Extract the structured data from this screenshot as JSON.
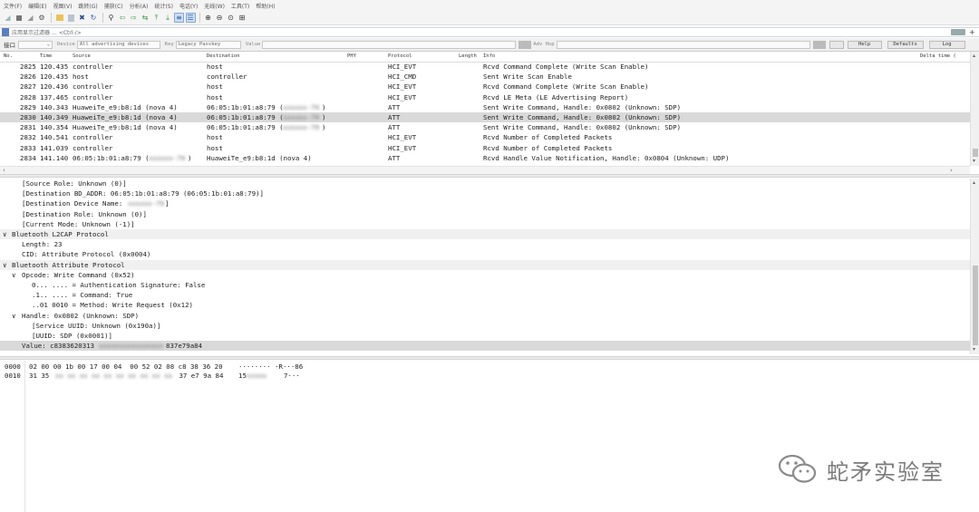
{
  "menu": [
    "文件(F)",
    "编辑(E)",
    "视图(V)",
    "跳转(G)",
    "捕获(C)",
    "分析(A)",
    "统计(S)",
    "电话(Y)",
    "无线(W)",
    "工具(T)",
    "帮助(H)"
  ],
  "filter": {
    "placeholder": "应用显示过滤器 … <Ctrl-/>"
  },
  "capture_options": {
    "interface_label": "接口",
    "device_label": "Device",
    "device_value": "All advertising devices",
    "key_label": "Key",
    "key_value": "Legacy Passkey",
    "value_label": "Value",
    "adv_hop_label": "Adv Hop",
    "help_label": "Help",
    "defaults_label": "Defaults",
    "log_label": "Log"
  },
  "columns": {
    "no": "No.",
    "time": "Time",
    "source": "Source",
    "destination": "Destination",
    "phy": "PHY",
    "protocol": "Protocol",
    "length": "Length",
    "info": "Info",
    "delta": "Delta time ("
  },
  "packets": [
    {
      "no": "2825",
      "time": "120.435",
      "src": "controller",
      "dst": "host",
      "proto": "HCI_EVT",
      "info": "Rcvd Command Complete (Write Scan Enable)"
    },
    {
      "no": "2826",
      "time": "120.435",
      "src": "host",
      "dst": "controller",
      "proto": "HCI_CMD",
      "info": "Sent Write Scan Enable"
    },
    {
      "no": "2827",
      "time": "120.436",
      "src": "controller",
      "dst": "host",
      "proto": "HCI_EVT",
      "info": "Rcvd Command Complete (Write Scan Enable)"
    },
    {
      "no": "2828",
      "time": "137.465",
      "src": "controller",
      "dst": "host",
      "proto": "HCI_EVT",
      "info": "Rcvd LE Meta (LE Advertising Report)"
    },
    {
      "no": "2829",
      "time": "140.343",
      "src": "HuaweiTe_e9:b8:1d (nova 4)",
      "dst": "06:05:1b:01:a8:79 (",
      "dst_blur": "xxxxxx-79",
      "dst_end": ")",
      "proto": "ATT",
      "info": "Sent Write Command, Handle: 0x0802 (Unknown: SDP)"
    },
    {
      "no": "2830",
      "time": "140.349",
      "src": "HuaweiTe_e9:b8:1d (nova 4)",
      "dst": "06:05:1b:01:a8:79 (",
      "dst_blur": "xxxxxx-79",
      "dst_end": ")",
      "proto": "ATT",
      "info": "Sent Write Command, Handle: 0x0802 (Unknown: SDP)"
    },
    {
      "no": "2831",
      "time": "140.354",
      "src": "HuaweiTe_e9:b8:1d (nova 4)",
      "dst": "06:05:1b:01:a8:79 (",
      "dst_blur": "xxxxxx-79",
      "dst_end": ")",
      "proto": "ATT",
      "info": "Sent Write Command, Handle: 0x0802 (Unknown: SDP)"
    },
    {
      "no": "2832",
      "time": "140.541",
      "src": "controller",
      "dst": "host",
      "proto": "HCI_EVT",
      "info": "Rcvd Number of Completed Packets"
    },
    {
      "no": "2833",
      "time": "141.039",
      "src": "controller",
      "dst": "host",
      "proto": "HCI_EVT",
      "info": "Rcvd Number of Completed Packets"
    },
    {
      "no": "2834",
      "time": "141.140",
      "src": "06:05:1b:01:a8:79 (",
      "src_blur": "xxxxxx-79",
      "src_end": ")",
      "dst": "HuaweiTe_e9:b8:1d (nova 4)",
      "proto": "ATT",
      "info": "Rcvd Handle Value Notification, Handle: 0x0804 (Unknown: UDP)"
    }
  ],
  "details": [
    {
      "indent": 3,
      "text": "[Source Role: Unknown (0)]"
    },
    {
      "indent": 3,
      "text": "[Destination BD_ADDR: 06:05:1b:01:a8:79 (06:05:1b:01:a8:79)]"
    },
    {
      "indent": 3,
      "text": "[Destination Device Name: ",
      "blur": "xxxxxx-79",
      "end": "]"
    },
    {
      "indent": 3,
      "text": "[Destination Role: Unknown (0)]"
    },
    {
      "indent": 3,
      "text": "[Current Mode: Unknown (-1)]"
    },
    {
      "indent": 0,
      "arrow": "∨",
      "text": "Bluetooth L2CAP Protocol",
      "section": true
    },
    {
      "indent": 3,
      "text": "Length: 23"
    },
    {
      "indent": 3,
      "text": "CID: Attribute Protocol (0x0004)"
    },
    {
      "indent": 0,
      "arrow": "∨",
      "text": "Bluetooth Attribute Protocol",
      "section": true
    },
    {
      "indent": 1,
      "arrow": "∨",
      "text": "Opcode: Write Command (0x52)"
    },
    {
      "indent": 4,
      "text": "0... .... = Authentication Signature: False"
    },
    {
      "indent": 4,
      "text": ".1.. .... = Command: True"
    },
    {
      "indent": 4,
      "text": "..01 0010 = Method: Write Request (0x12)"
    },
    {
      "indent": 1,
      "arrow": "∨",
      "text": "Handle: 0x0802 (Unknown: SDP)"
    },
    {
      "indent": 4,
      "text": "[Service UUID: Unknown (0x190a)]"
    },
    {
      "indent": 4,
      "text": "[UUID: SDP (0x0001)]"
    },
    {
      "indent": 3,
      "text": "Value: c8383620313",
      "blur": "xxxxxxxxxxxxxxxx",
      "end": "837e79a84",
      "selected": true
    }
  ],
  "bytes": [
    {
      "offset": "0000",
      "hex": "02 00 00 1b 00 17 00 04  00 52 02 08 c8 38 36 20",
      "ascii": "········ ·R···86 "
    },
    {
      "offset": "0010",
      "hex": "31 35 ",
      "hex_blur": "xx xx xx xx xx xx xx xx xx xx",
      "hex_end": " 37 e7 9a 84",
      "ascii": "15",
      "ascii_blur": "xxxxx",
      "ascii_end": "7···"
    }
  ],
  "watermark": "蛇矛实验室"
}
